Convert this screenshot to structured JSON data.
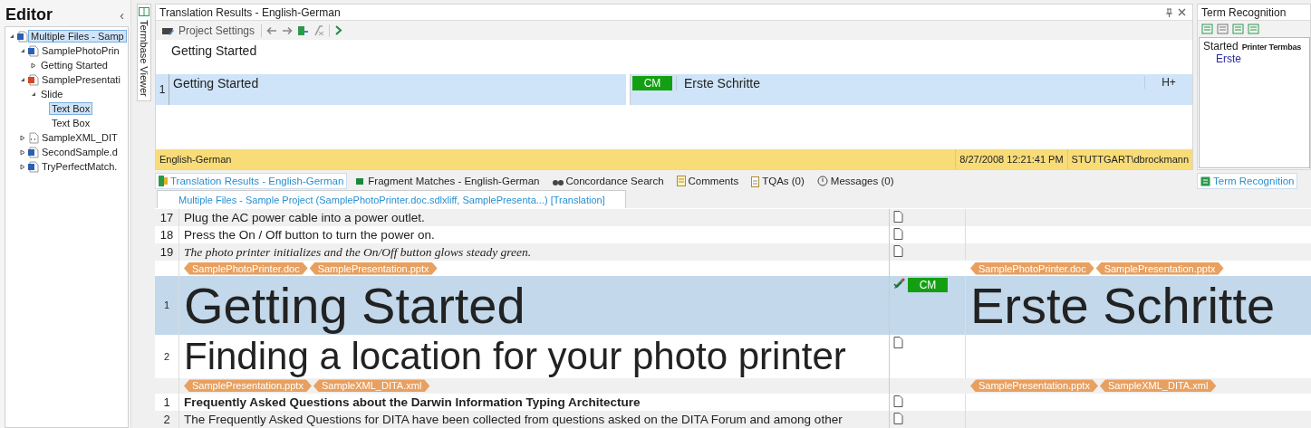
{
  "sidebar": {
    "title": "Editor",
    "collapse_glyph": "‹",
    "tree": [
      {
        "label": "Multiple Files - Samp",
        "kind": "project",
        "expanded": true,
        "selected": true,
        "children": [
          {
            "label": "SamplePhotoPrin",
            "kind": "word",
            "expanded": true,
            "selected": false,
            "children": [
              {
                "label": "Getting Started",
                "expanded": false,
                "selected": false
              }
            ]
          },
          {
            "label": "SamplePresentati",
            "kind": "powerpoint",
            "expanded": true,
            "selected": false,
            "children": [
              {
                "label": "Slide",
                "expanded": true,
                "selected": false,
                "children": [
                  {
                    "label": "Text Box",
                    "selected": true
                  },
                  {
                    "label": "Text Box",
                    "selected": false
                  }
                ]
              }
            ]
          },
          {
            "label": "SampleXML_DIT",
            "kind": "xml",
            "expanded": false,
            "selected": false
          },
          {
            "label": "SecondSample.d",
            "kind": "word",
            "expanded": false,
            "selected": false
          },
          {
            "label": "TryPerfectMatch.",
            "kind": "word",
            "expanded": false,
            "selected": false
          }
        ]
      }
    ]
  },
  "side_tab": {
    "label": "Termbase Viewer"
  },
  "translation_results": {
    "title": "Translation Results - English-German",
    "project_settings": "Project Settings",
    "source": "Getting Started",
    "result": {
      "number": "1",
      "source": "Getting Started",
      "badge": "CM",
      "target": "Erste Schritte",
      "flag": "H+"
    },
    "status": {
      "language_pair": "English-German",
      "date": "8/27/2008 12:21:41 PM",
      "user": "STUTTGART\\dbrockmann"
    }
  },
  "term_recognition": {
    "title": "Term Recognition",
    "source_term": "Started",
    "termbase": "Printer Termbas",
    "target_term": "Erste"
  },
  "tabs": [
    {
      "label": "Translation Results - English-German",
      "selected": true
    },
    {
      "label": "Fragment Matches - English-German",
      "selected": false
    },
    {
      "label": "Concordance Search",
      "selected": false
    },
    {
      "label": "Comments",
      "selected": false
    },
    {
      "label": "TQAs (0)",
      "selected": false
    },
    {
      "label": "Messages (0)",
      "selected": false
    }
  ],
  "right_tabs": [
    {
      "label": "Term Recognition",
      "selected": true
    }
  ],
  "document_tab": {
    "label": "Multiple Files - Sample Project (SamplePhotoPrinter.doc.sdlxliff, SamplePresenta...) [Translation]"
  },
  "editor_rows": [
    {
      "kind": "plain",
      "number": "17",
      "source": "Plug the AC power cable into a power outlet.",
      "selected": false
    },
    {
      "kind": "plain",
      "number": "18",
      "source": "Press the On / Off button to turn the power on.",
      "selected": false
    },
    {
      "kind": "italic",
      "number": "19",
      "source": "The photo printer initializes and the On/Off button glows steady green.",
      "selected": false
    },
    {
      "kind": "tags",
      "source_tags": [
        "SamplePhotoPrinter.doc",
        "SamplePresentation.pptx"
      ],
      "target_tags": [
        "SamplePhotoPrinter.doc",
        "SamplePresentation.pptx"
      ]
    },
    {
      "kind": "title",
      "number": "1",
      "source": "Getting Started",
      "selected": true,
      "badge": "CM",
      "target": "Erste Schritte"
    },
    {
      "kind": "heading",
      "number": "2",
      "source": "Finding a location for your photo printer",
      "selected": false
    },
    {
      "kind": "tags",
      "source_tags": [
        "SamplePresentation.pptx",
        "SampleXML_DITA.xml"
      ],
      "target_tags": [
        "SamplePresentation.pptx",
        "SampleXML_DITA.xml"
      ]
    },
    {
      "kind": "bold",
      "number": "1",
      "source": "Frequently Asked Questions about the Darwin Information Typing Architecture",
      "selected": false
    },
    {
      "kind": "plain",
      "number": "2",
      "source": "The Frequently Asked Questions for DITA have been collected from questions asked on the DITA Forum and among other",
      "selected": false
    }
  ]
}
